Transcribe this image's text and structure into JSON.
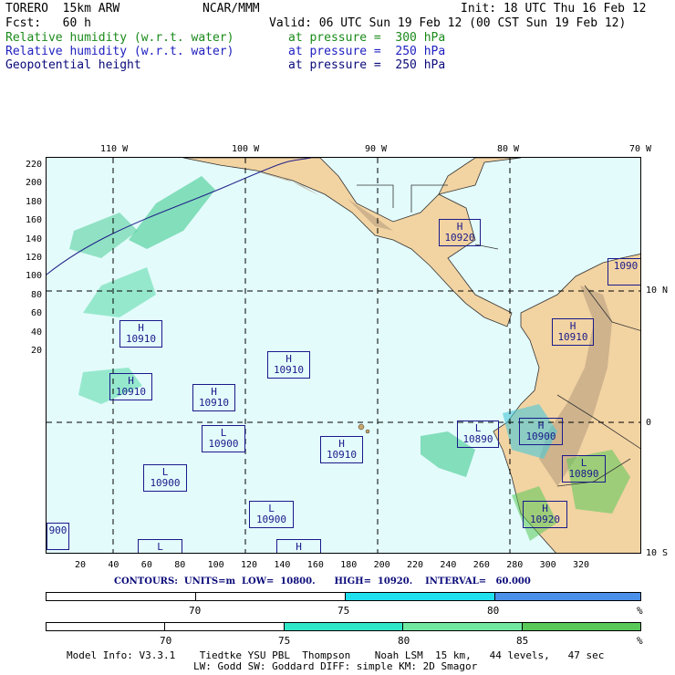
{
  "header": {
    "model": "TORERO  15km ARW",
    "source": "NCAR/MMM",
    "init": "Init: 18 UTC Thu 16 Feb 12",
    "fcst": "Fcst:   60 h",
    "valid": "Valid: 06 UTC Sun 19 Feb 12 (00 CST Sun 19 Feb 12)",
    "fields": [
      {
        "name": "Relative humidity (w.r.t. water)",
        "level": "at pressure =  300 hPa",
        "color": "#1a8a1a"
      },
      {
        "name": "Relative humidity (w.r.t. water)",
        "level": "at pressure =  250 hPa",
        "color": "#2020c0"
      },
      {
        "name": "Geopotential height",
        "level": "at pressure =  250 hPa",
        "color": "#0a0a7a"
      }
    ]
  },
  "axes": {
    "top_lon": [
      "110 W",
      "100 W",
      "90 W",
      "80 W",
      "70 W"
    ],
    "right_lat": [
      "10 N",
      "0",
      "10 S"
    ],
    "left_y": [
      "220",
      "200",
      "180",
      "160",
      "140",
      "120",
      "100",
      "80",
      "60",
      "40",
      "20"
    ],
    "bottom_x": [
      "20",
      "40",
      "60",
      "80",
      "100",
      "120",
      "140",
      "160",
      "180",
      "200",
      "220",
      "240",
      "260",
      "280",
      "300",
      "320"
    ]
  },
  "highs_lows": [
    {
      "type": "H",
      "value": "10920"
    },
    {
      "type": "H",
      "value": "10910"
    },
    {
      "type": "H",
      "value": "10910"
    },
    {
      "type": "H",
      "value": "10910"
    },
    {
      "type": "H",
      "value": "10910"
    },
    {
      "type": "H",
      "value": "10910"
    },
    {
      "type": "H",
      "value": "10910"
    },
    {
      "type": "L",
      "value": "10900"
    },
    {
      "type": "L",
      "value": "10900"
    },
    {
      "type": "L",
      "value": "10890"
    },
    {
      "type": "H",
      "value": "10900"
    },
    {
      "type": "L",
      "value": "10890"
    },
    {
      "type": "L",
      "value": "10900"
    },
    {
      "type": "H",
      "value": "10920"
    },
    {
      "type": "",
      "value": "900"
    },
    {
      "type": "L",
      "value": ""
    },
    {
      "type": "H",
      "value": ""
    },
    {
      "type": "",
      "value": "1090"
    }
  ],
  "contours_line": "CONTOURS:  UNITS=m  LOW=  10800.      HIGH=  10920.    INTERVAL=   60.000",
  "colorbar_250": {
    "labels": [
      "70",
      "75",
      "80"
    ],
    "unit": "%",
    "colors": [
      "#ffffff",
      "#ffffff",
      "#20e0f0",
      "#4a90e8"
    ]
  },
  "colorbar_300": {
    "labels": [
      "70",
      "75",
      "80",
      "85"
    ],
    "unit": "%",
    "colors": [
      "#ffffff",
      "#ffffff",
      "#30e8c8",
      "#70e8a0",
      "#58c858"
    ]
  },
  "footer": {
    "line1": "Model Info: V3.3.1    Tiedtke YSU PBL  Thompson    Noah LSM  15 km,   44 levels,   47 sec",
    "line2": "LW: Godd SW: Goddard DIFF: simple KM: 2D Smagor"
  }
}
